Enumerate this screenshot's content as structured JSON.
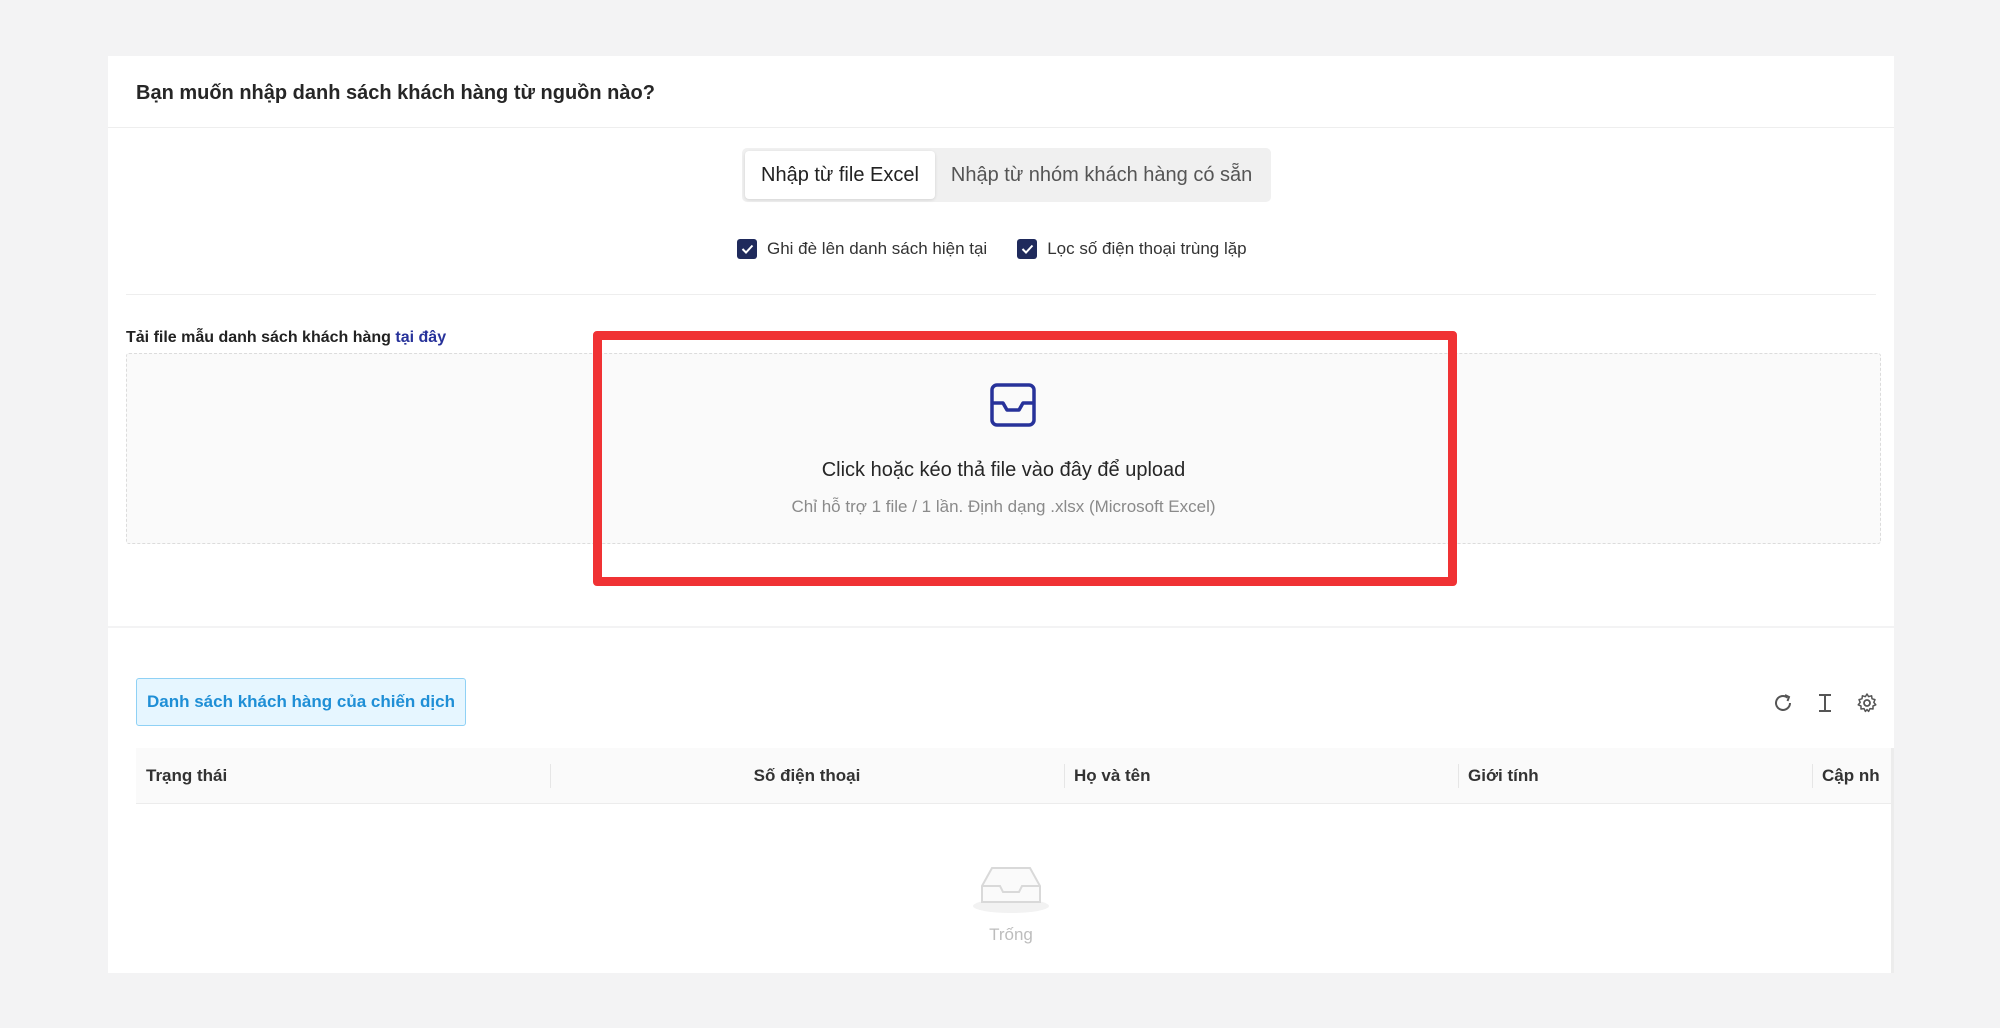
{
  "import_section": {
    "title": "Bạn muốn nhập danh sách khách hàng từ nguồn nào?",
    "source_tabs": [
      {
        "label": "Nhập từ file Excel",
        "active": true
      },
      {
        "label": "Nhập từ nhóm khách hàng có sẵn",
        "active": false
      }
    ],
    "options": [
      {
        "label": "Ghi đè lên danh sách hiện tại",
        "checked": true
      },
      {
        "label": "Lọc số điện thoại trùng lặp",
        "checked": true
      }
    ],
    "template_text": "Tải file mẫu danh sách khách hàng ",
    "template_link": "tại đây",
    "upload": {
      "icon": "inbox-icon",
      "title": "Click hoặc kéo thả file vào đây để upload",
      "hint": "Chỉ hỗ trợ 1 file / 1 lần. Định dạng .xlsx (Microsoft Excel)"
    },
    "highlight_color": "#f03234"
  },
  "customer_list": {
    "tag_label": "Danh sách khách hàng của chiến dịch",
    "tools": [
      "reload-icon",
      "column-height-icon",
      "settings-icon"
    ],
    "columns": [
      "Trạng thái",
      "Số điện thoại",
      "Họ và tên",
      "Giới tính",
      "Cập nh"
    ],
    "empty_text": "Trống"
  },
  "colors": {
    "accent_navy": "#1f2a5c",
    "link_blue": "#27329a",
    "tag_blue": "#1f8fd6"
  }
}
